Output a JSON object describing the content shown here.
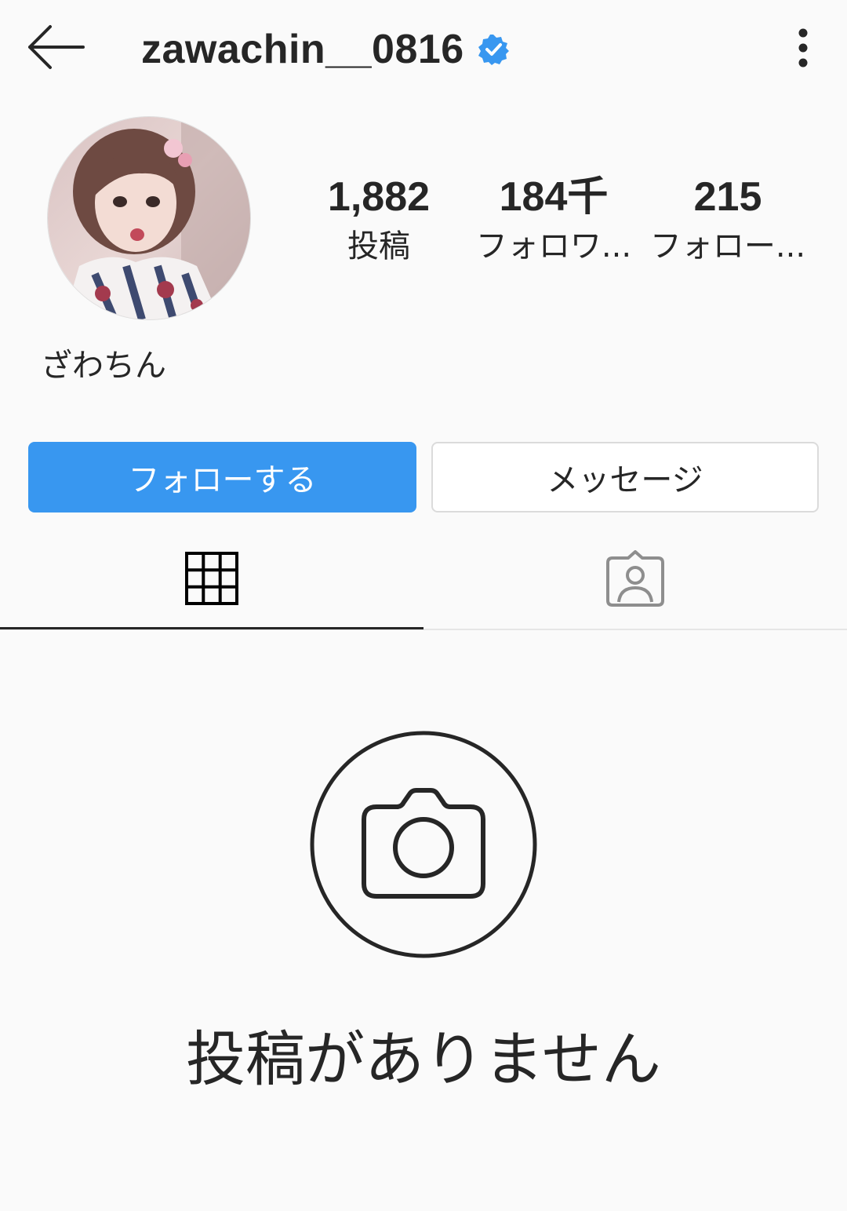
{
  "header": {
    "username": "zawachin__0816",
    "verified_icon": "verified-badge-icon",
    "back_icon": "back-arrow-icon",
    "more_icon": "more-vertical-icon"
  },
  "profile": {
    "display_name": "ざわちん",
    "avatar": "profile-photo"
  },
  "stats": [
    {
      "value": "1,882",
      "label": "投稿"
    },
    {
      "value": "184千",
      "label": "フォロワ..."
    },
    {
      "value": "215",
      "label": "フォロー..."
    }
  ],
  "actions": {
    "follow_label": "フォローする",
    "message_label": "メッセージ"
  },
  "tabs": [
    {
      "icon": "grid-icon",
      "active": true
    },
    {
      "icon": "tagged-person-icon",
      "active": false
    }
  ],
  "empty_state": {
    "icon": "camera-icon",
    "text": "投稿がありません"
  },
  "colors": {
    "background": "#fafafa",
    "accent": "#3897f0",
    "text": "#262626",
    "verified": "#3897f0",
    "inactive_icon": "#8e8e8e"
  }
}
